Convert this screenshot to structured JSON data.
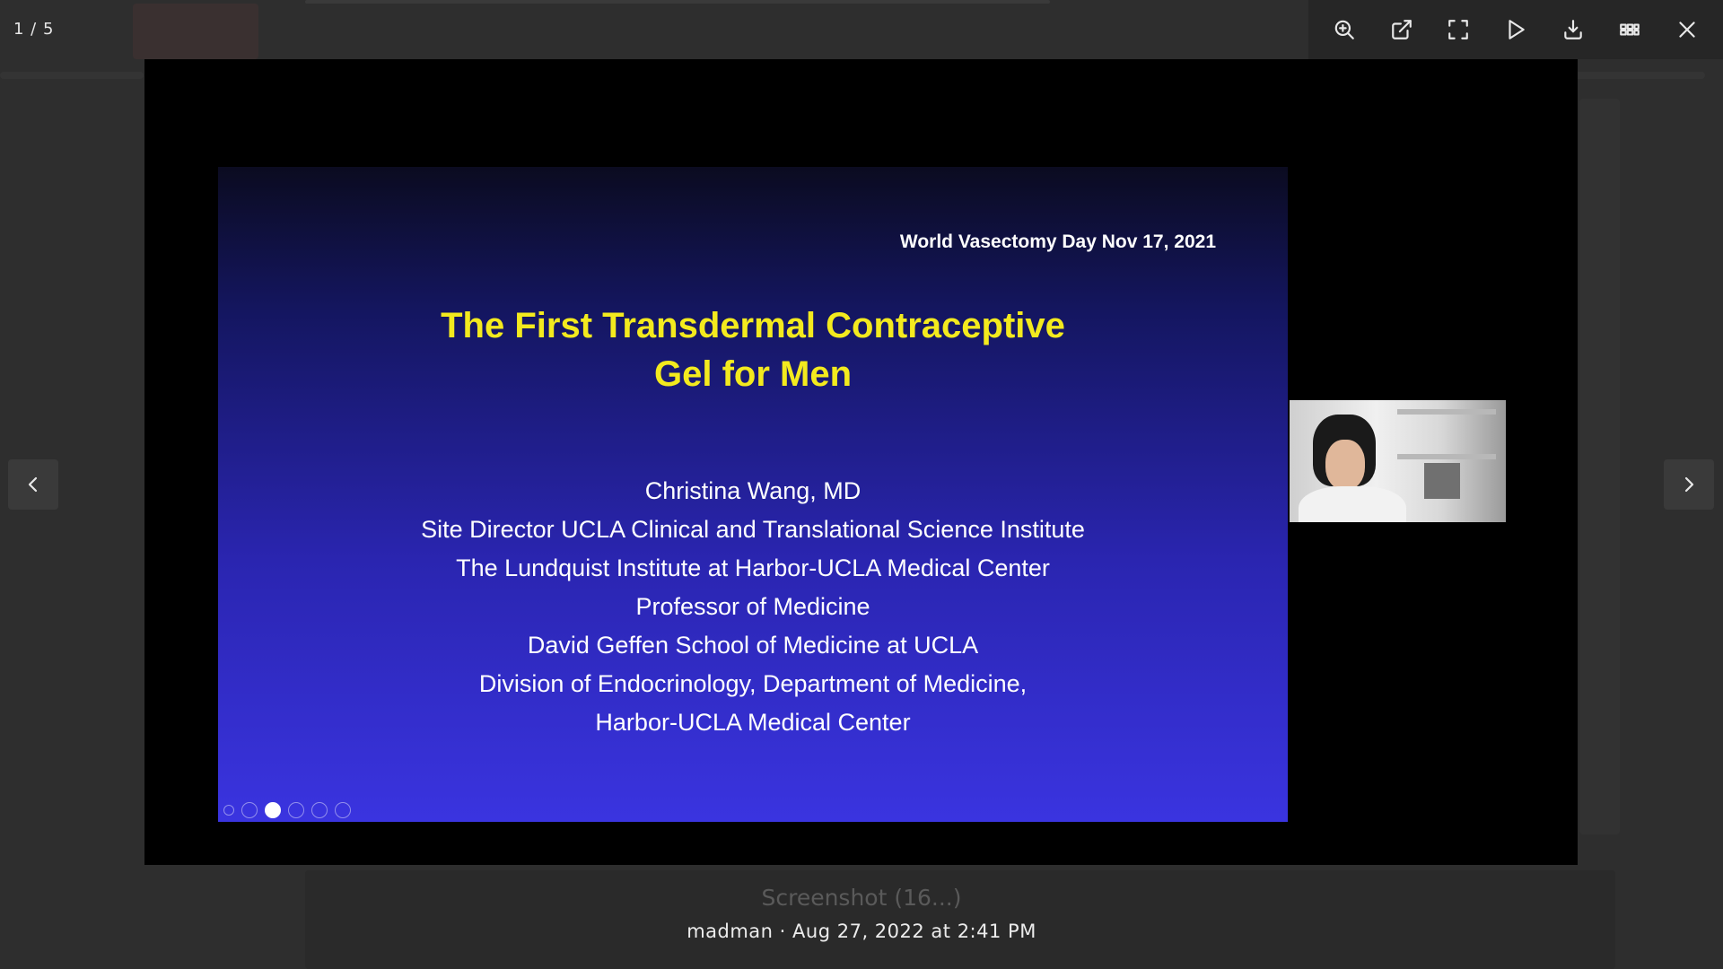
{
  "viewer": {
    "counter": "1 / 5",
    "caption_title": "Screenshot (16...)",
    "author": "madman",
    "separator": "·",
    "timestamp": "Aug 27, 2022 at 2:41 PM"
  },
  "toolbar": {
    "buttons": [
      {
        "name": "zoom-in",
        "icon": "magnifier-plus-icon"
      },
      {
        "name": "open-external",
        "icon": "external-link-icon"
      },
      {
        "name": "fullscreen",
        "icon": "fullscreen-icon"
      },
      {
        "name": "slideshow",
        "icon": "play-icon"
      },
      {
        "name": "download",
        "icon": "download-icon"
      },
      {
        "name": "thumbnails",
        "icon": "grid-icon"
      },
      {
        "name": "close",
        "icon": "close-icon"
      }
    ]
  },
  "slide": {
    "date": "World Vasectomy Day Nov 17, 2021",
    "title_line1": "The First Transdermal Contraceptive",
    "title_line2": "Gel for Men",
    "author_lines": [
      "Christina Wang, MD",
      "Site Director UCLA Clinical and Translational Science Institute",
      "The Lundquist Institute at Harbor-UCLA Medical Center",
      "Professor of Medicine",
      "David Geffen School of Medicine at UCLA",
      "Division of Endocrinology, Department of Medicine,",
      "Harbor-UCLA Medical Center"
    ]
  },
  "colors": {
    "title_yellow": "#f3ea1e",
    "slide_blue": "#3a34e0",
    "toolbar_bg": "#262626"
  }
}
